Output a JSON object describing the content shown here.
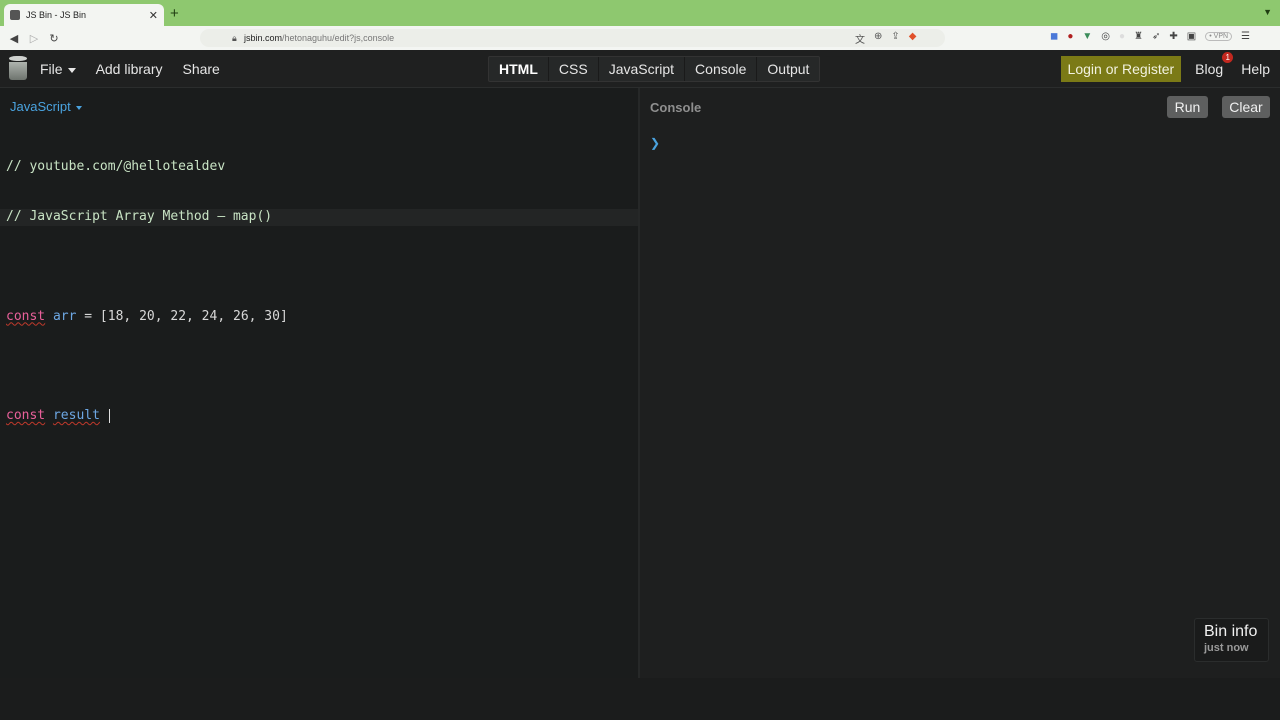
{
  "browser": {
    "tab_title": "JS Bin - JS Bin",
    "tab_close": "✕",
    "new_tab": "+",
    "url_host": "jsbin.com",
    "url_path": "/hetonaguhu/edit?js,console",
    "vpn_label": "• VPN"
  },
  "toolbar": {
    "file_label": "File",
    "add_library_label": "Add library",
    "share_label": "Share",
    "panels": [
      "HTML",
      "CSS",
      "JavaScript",
      "Console",
      "Output"
    ],
    "login_label": "Login or Register",
    "blog_label": "Blog",
    "blog_badge": "1",
    "help_label": "Help"
  },
  "editor": {
    "language": "JavaScript",
    "comment_1": "// youtube.com/@hellotealdev",
    "comment_2": "// JavaScript Array Method – map()",
    "line3_kw": "const",
    "line3_var": "arr",
    "line3_rest": " = [18, 20, 22, 24, 26, 30]",
    "line5_kw": "const",
    "line5_var": "result"
  },
  "console": {
    "title": "Console",
    "run_label": "Run",
    "clear_label": "Clear",
    "prompt": "❯"
  },
  "bin_info": {
    "title": "Bin info",
    "subtitle": "just now"
  },
  "colors": {
    "tabbar": "#8ec86f",
    "login_button": "#7b7a16",
    "keyword": "#e9609a",
    "variable": "#6da7e3",
    "comment": "#c8e3c4",
    "accent_blue": "#4aa3df"
  }
}
